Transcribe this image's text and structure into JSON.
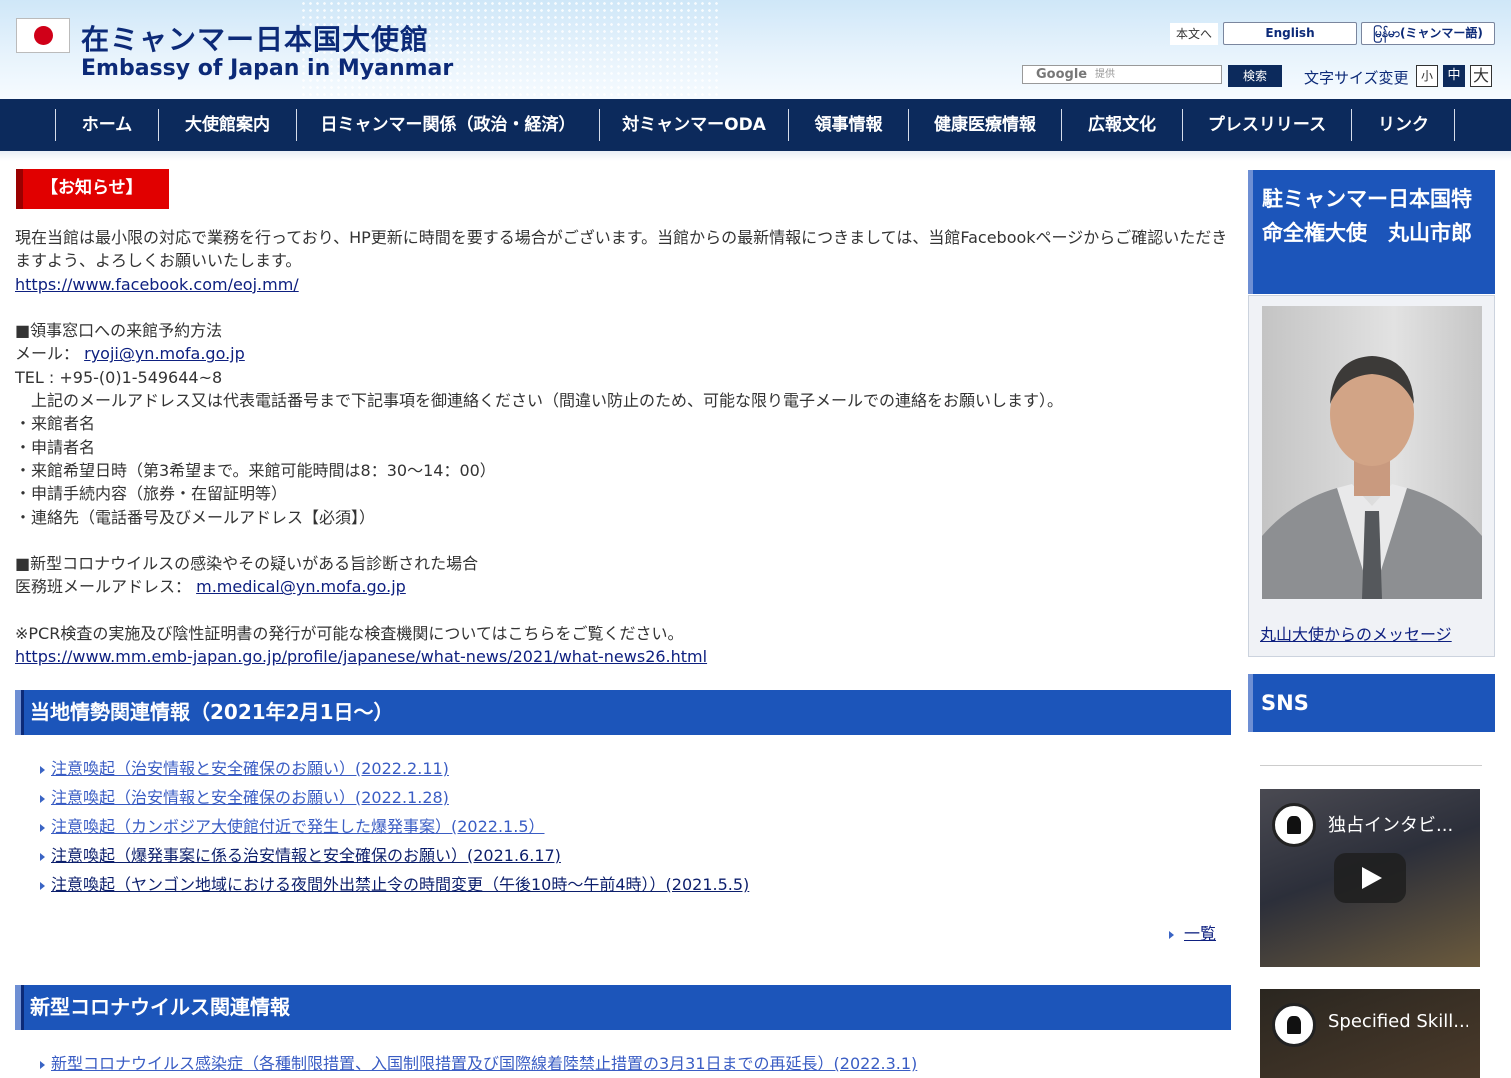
{
  "header": {
    "title_ja": "在ミャンマー日本国大使館",
    "title_en": "Embassy of Japan in Myanmar",
    "skip_link": "本文へ",
    "lang_english": "English",
    "lang_myanmar": "မြန်မာ(ミャンマー語)",
    "search_placeholder_brand": "Google",
    "search_placeholder_suffix": "提供",
    "search_button": "検索",
    "font_size_label": "文字サイズ変更",
    "font_small": "小",
    "font_medium": "中",
    "font_large": "大"
  },
  "nav": {
    "items": [
      "ホーム",
      "大使館案内",
      "日ミャンマー関係（政治・経済）",
      "対ミャンマーODA",
      "領事情報",
      "健康医療情報",
      "広報文化",
      "プレスリリース",
      "リンク"
    ]
  },
  "notice": {
    "label": "【お知らせ】",
    "intro": "現在当館は最小限の対応で業務を行っており、HP更新に時間を要する場合がございます。当館からの最新情報につきましては、当館Facebookページからご確認いただきますよう、よろしくお願いいたします。",
    "facebook_url": "https://www.facebook.com/eoj.mm/",
    "reservation_heading": "■領事窓口への来館予約方法",
    "mail_label": "メール：",
    "mail_address": "ryoji@yn.mofa.go.jp",
    "tel": "TEL : +95-(0)1-549644~8",
    "contact_instructions": "　上記のメールアドレス又は代表電話番号まで下記事項を御連絡ください（間違い防止のため、可能な限り電子メールでの連絡をお願いします）。",
    "items": [
      "・来館者名",
      "・申請者名",
      "・来館希望日時（第3希望まで。来館可能時間は8：30〜14：00）",
      "・申請手続内容（旅券・在留証明等）",
      "・連絡先（電話番号及びメールアドレス【必須】）"
    ],
    "covid_heading": "■新型コロナウイルスの感染やその疑いがある旨診断された場合",
    "medical_label": "医務班メールアドレス：",
    "medical_address": "m.medical@yn.mofa.go.jp",
    "pcr_note": "※PCR検査の実施及び陰性証明書の発行が可能な検査機関についてはこちらをご覧ください。",
    "pcr_url": "https://www.mm.emb-japan.go.jp/profile/japanese/what-news/2021/what-news26.html"
  },
  "situation": {
    "heading": "当地情勢関連情報（2021年2月1日〜）",
    "links": [
      "注意喚起（治安情報と安全確保のお願い）(2022.2.11)",
      "注意喚起（治安情報と安全確保のお願い）(2022.1.28)",
      "注意喚起（カンボジア大使館付近で発生した爆発事案）(2022.1.5）",
      "注意喚起（爆発事案に係る治安情報と安全確保のお願い）(2021.6.17)",
      "注意喚起（ヤンゴン地域における夜間外出禁止令の時間変更（午後10時〜午前4時））(2021.5.5)"
    ],
    "more": "一覧"
  },
  "covid": {
    "heading": "新型コロナウイルス関連情報",
    "links": [
      "新型コロナウイルス感染症（各種制限措置、入国制限措置及び国際線着陸禁止措置の3月31日までの再延長）(2022.3.1)"
    ]
  },
  "sidebar": {
    "ambassador_title": "駐ミャンマー日本国特命全権大使　丸山市郎",
    "ambassador_link": "丸山大使からのメッセージ",
    "sns_heading": "SNS",
    "video1_title": "独占インタビ...",
    "video2_title": "Specified Skill..."
  },
  "colors": {
    "navy": "#0c2a5c",
    "section_blue": "#1c55ba",
    "notice_red": "#e10000",
    "link": "#0e2080"
  }
}
